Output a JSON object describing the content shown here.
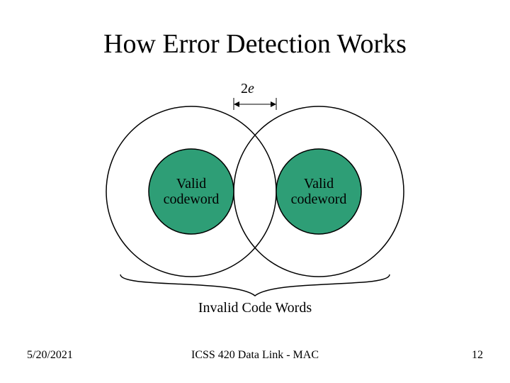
{
  "title": "How Error Detection Works",
  "distance_label_prefix": "2",
  "distance_label_var": "e",
  "left_codeword_line1": "Valid",
  "left_codeword_line2": "codeword",
  "right_codeword_line1": "Valid",
  "right_codeword_line2": "codeword",
  "invalid_label": "Invalid Code Words",
  "footer": {
    "date": "5/20/2021",
    "center": "ICSS 420 Data Link - MAC",
    "page": "12"
  },
  "colors": {
    "codeword_fill": "#2e9e76",
    "stroke": "#000000"
  }
}
